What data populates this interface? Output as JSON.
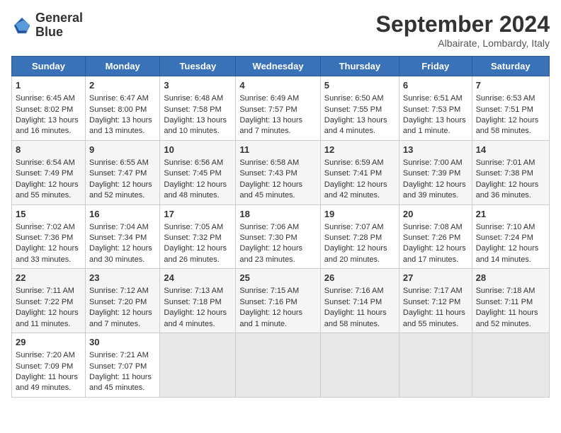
{
  "header": {
    "logo_line1": "General",
    "logo_line2": "Blue",
    "month_title": "September 2024",
    "subtitle": "Albairate, Lombardy, Italy"
  },
  "days_of_week": [
    "Sunday",
    "Monday",
    "Tuesday",
    "Wednesday",
    "Thursday",
    "Friday",
    "Saturday"
  ],
  "weeks": [
    [
      {
        "day": "1",
        "info": "Sunrise: 6:45 AM\nSunset: 8:02 PM\nDaylight: 13 hours and 16 minutes."
      },
      {
        "day": "2",
        "info": "Sunrise: 6:47 AM\nSunset: 8:00 PM\nDaylight: 13 hours and 13 minutes."
      },
      {
        "day": "3",
        "info": "Sunrise: 6:48 AM\nSunset: 7:58 PM\nDaylight: 13 hours and 10 minutes."
      },
      {
        "day": "4",
        "info": "Sunrise: 6:49 AM\nSunset: 7:57 PM\nDaylight: 13 hours and 7 minutes."
      },
      {
        "day": "5",
        "info": "Sunrise: 6:50 AM\nSunset: 7:55 PM\nDaylight: 13 hours and 4 minutes."
      },
      {
        "day": "6",
        "info": "Sunrise: 6:51 AM\nSunset: 7:53 PM\nDaylight: 13 hours and 1 minute."
      },
      {
        "day": "7",
        "info": "Sunrise: 6:53 AM\nSunset: 7:51 PM\nDaylight: 12 hours and 58 minutes."
      }
    ],
    [
      {
        "day": "8",
        "info": "Sunrise: 6:54 AM\nSunset: 7:49 PM\nDaylight: 12 hours and 55 minutes."
      },
      {
        "day": "9",
        "info": "Sunrise: 6:55 AM\nSunset: 7:47 PM\nDaylight: 12 hours and 52 minutes."
      },
      {
        "day": "10",
        "info": "Sunrise: 6:56 AM\nSunset: 7:45 PM\nDaylight: 12 hours and 48 minutes."
      },
      {
        "day": "11",
        "info": "Sunrise: 6:58 AM\nSunset: 7:43 PM\nDaylight: 12 hours and 45 minutes."
      },
      {
        "day": "12",
        "info": "Sunrise: 6:59 AM\nSunset: 7:41 PM\nDaylight: 12 hours and 42 minutes."
      },
      {
        "day": "13",
        "info": "Sunrise: 7:00 AM\nSunset: 7:39 PM\nDaylight: 12 hours and 39 minutes."
      },
      {
        "day": "14",
        "info": "Sunrise: 7:01 AM\nSunset: 7:38 PM\nDaylight: 12 hours and 36 minutes."
      }
    ],
    [
      {
        "day": "15",
        "info": "Sunrise: 7:02 AM\nSunset: 7:36 PM\nDaylight: 12 hours and 33 minutes."
      },
      {
        "day": "16",
        "info": "Sunrise: 7:04 AM\nSunset: 7:34 PM\nDaylight: 12 hours and 30 minutes."
      },
      {
        "day": "17",
        "info": "Sunrise: 7:05 AM\nSunset: 7:32 PM\nDaylight: 12 hours and 26 minutes."
      },
      {
        "day": "18",
        "info": "Sunrise: 7:06 AM\nSunset: 7:30 PM\nDaylight: 12 hours and 23 minutes."
      },
      {
        "day": "19",
        "info": "Sunrise: 7:07 AM\nSunset: 7:28 PM\nDaylight: 12 hours and 20 minutes."
      },
      {
        "day": "20",
        "info": "Sunrise: 7:08 AM\nSunset: 7:26 PM\nDaylight: 12 hours and 17 minutes."
      },
      {
        "day": "21",
        "info": "Sunrise: 7:10 AM\nSunset: 7:24 PM\nDaylight: 12 hours and 14 minutes."
      }
    ],
    [
      {
        "day": "22",
        "info": "Sunrise: 7:11 AM\nSunset: 7:22 PM\nDaylight: 12 hours and 11 minutes."
      },
      {
        "day": "23",
        "info": "Sunrise: 7:12 AM\nSunset: 7:20 PM\nDaylight: 12 hours and 7 minutes."
      },
      {
        "day": "24",
        "info": "Sunrise: 7:13 AM\nSunset: 7:18 PM\nDaylight: 12 hours and 4 minutes."
      },
      {
        "day": "25",
        "info": "Sunrise: 7:15 AM\nSunset: 7:16 PM\nDaylight: 12 hours and 1 minute."
      },
      {
        "day": "26",
        "info": "Sunrise: 7:16 AM\nSunset: 7:14 PM\nDaylight: 11 hours and 58 minutes."
      },
      {
        "day": "27",
        "info": "Sunrise: 7:17 AM\nSunset: 7:12 PM\nDaylight: 11 hours and 55 minutes."
      },
      {
        "day": "28",
        "info": "Sunrise: 7:18 AM\nSunset: 7:11 PM\nDaylight: 11 hours and 52 minutes."
      }
    ],
    [
      {
        "day": "29",
        "info": "Sunrise: 7:20 AM\nSunset: 7:09 PM\nDaylight: 11 hours and 49 minutes."
      },
      {
        "day": "30",
        "info": "Sunrise: 7:21 AM\nSunset: 7:07 PM\nDaylight: 11 hours and 45 minutes."
      },
      {
        "day": "",
        "info": ""
      },
      {
        "day": "",
        "info": ""
      },
      {
        "day": "",
        "info": ""
      },
      {
        "day": "",
        "info": ""
      },
      {
        "day": "",
        "info": ""
      }
    ]
  ]
}
